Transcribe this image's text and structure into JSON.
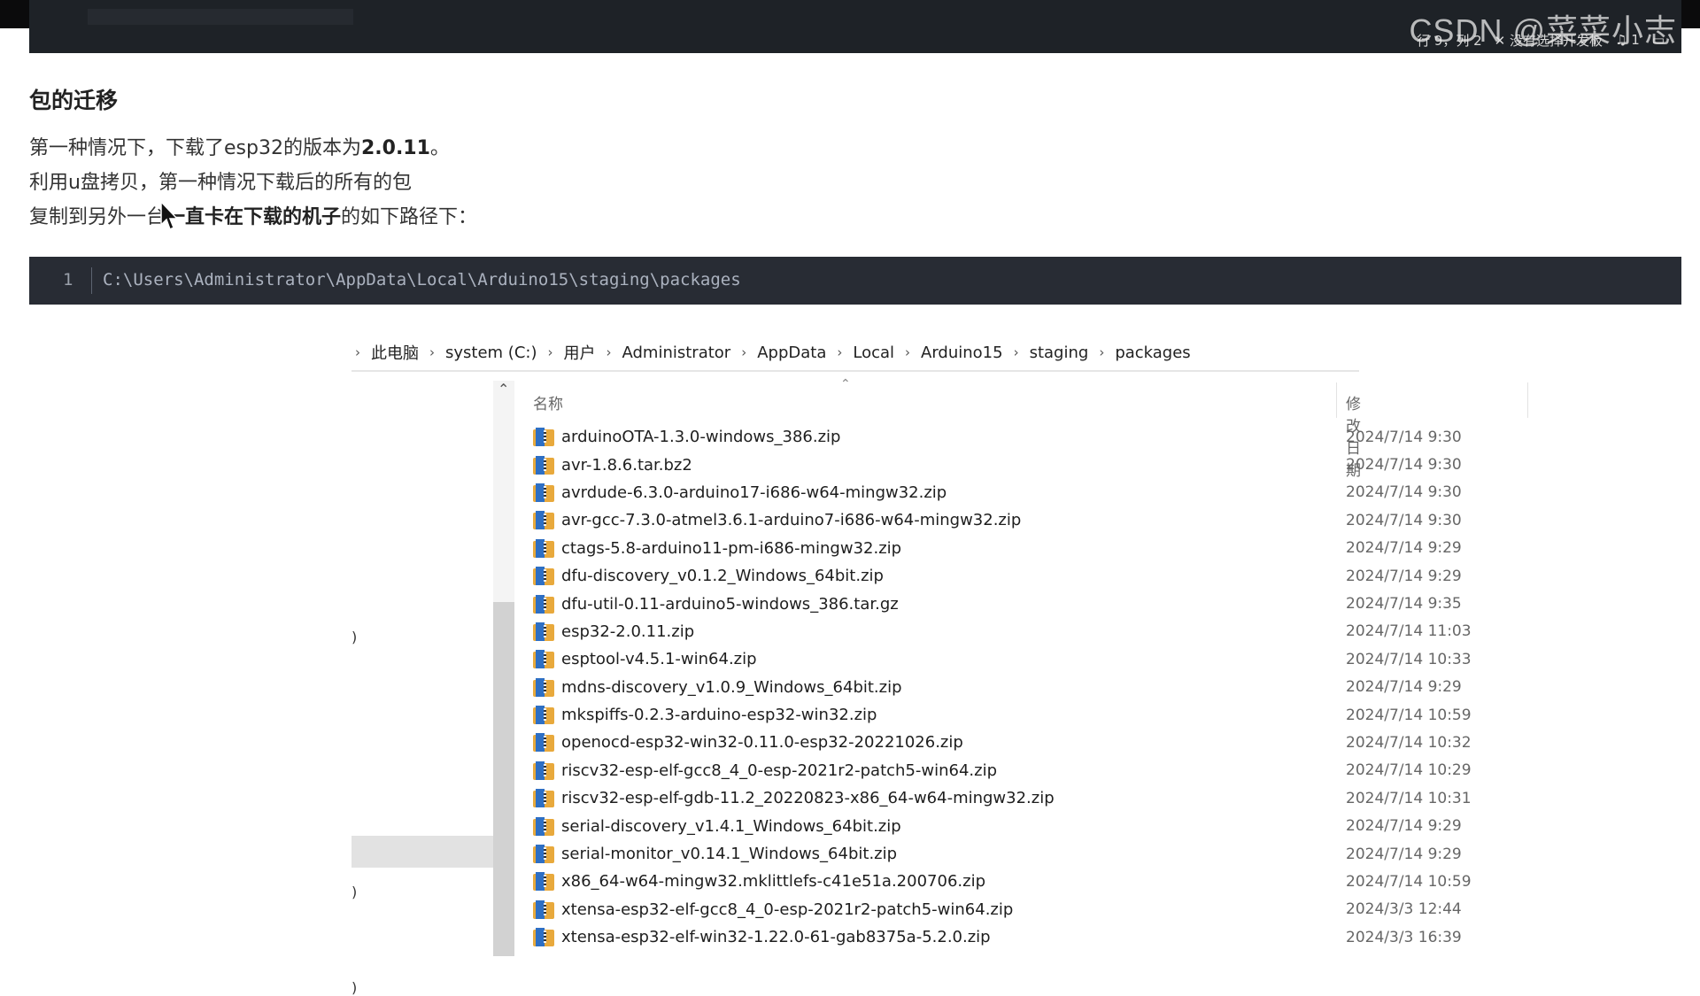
{
  "editor": {
    "status": {
      "position": "行 9，列 2",
      "board": "没有选择开发板",
      "notifications": "1"
    },
    "watermark": "CSDN @菜菜小志"
  },
  "article": {
    "heading": "包的迁移",
    "line1": {
      "text": "第一种情况下，下载了esp32的版本为",
      "bold": "2.0.11",
      "suffix": "。"
    },
    "line2": "利用u盘拷贝，第一种情况下载后的所有的包",
    "line3": {
      "prefix": "复制到另外一台",
      "bold": "一直卡在下载的机子",
      "suffix": "的如下路径下："
    }
  },
  "code": {
    "line_number": "1",
    "text": "C:\\Users\\Administrator\\AppData\\Local\\Arduino15\\staging\\packages"
  },
  "explorer": {
    "breadcrumbs": [
      "此电脑",
      "system (C:)",
      "用户",
      "Administrator",
      "AppData",
      "Local",
      "Arduino15",
      "staging",
      "packages"
    ],
    "columns": {
      "name": "名称",
      "date": "修改日期"
    },
    "files": [
      {
        "name": "arduinoOTA-1.3.0-windows_386.zip",
        "date": "2024/7/14 9:30"
      },
      {
        "name": "avr-1.8.6.tar.bz2",
        "date": "2024/7/14 9:30"
      },
      {
        "name": "avrdude-6.3.0-arduino17-i686-w64-mingw32.zip",
        "date": "2024/7/14 9:30"
      },
      {
        "name": "avr-gcc-7.3.0-atmel3.6.1-arduino7-i686-w64-mingw32.zip",
        "date": "2024/7/14 9:30"
      },
      {
        "name": "ctags-5.8-arduino11-pm-i686-mingw32.zip",
        "date": "2024/7/14 9:29"
      },
      {
        "name": "dfu-discovery_v0.1.2_Windows_64bit.zip",
        "date": "2024/7/14 9:29"
      },
      {
        "name": "dfu-util-0.11-arduino5-windows_386.tar.gz",
        "date": "2024/7/14 9:35"
      },
      {
        "name": "esp32-2.0.11.zip",
        "date": "2024/7/14 11:03"
      },
      {
        "name": "esptool-v4.5.1-win64.zip",
        "date": "2024/7/14 10:33"
      },
      {
        "name": "mdns-discovery_v1.0.9_Windows_64bit.zip",
        "date": "2024/7/14 9:29"
      },
      {
        "name": "mkspiffs-0.2.3-arduino-esp32-win32.zip",
        "date": "2024/7/14 10:59"
      },
      {
        "name": "openocd-esp32-win32-0.11.0-esp32-20221026.zip",
        "date": "2024/7/14 10:32"
      },
      {
        "name": "riscv32-esp-elf-gcc8_4_0-esp-2021r2-patch5-win64.zip",
        "date": "2024/7/14 10:29"
      },
      {
        "name": "riscv32-esp-elf-gdb-11.2_20220823-x86_64-w64-mingw32.zip",
        "date": "2024/7/14 10:31"
      },
      {
        "name": "serial-discovery_v1.4.1_Windows_64bit.zip",
        "date": "2024/7/14 9:29"
      },
      {
        "name": "serial-monitor_v0.14.1_Windows_64bit.zip",
        "date": "2024/7/14 9:29"
      },
      {
        "name": "x86_64-w64-mingw32.mklittlefs-c41e51a.200706.zip",
        "date": "2024/7/14 10:59"
      },
      {
        "name": "xtensa-esp32-elf-gcc8_4_0-esp-2021r2-patch5-win64.zip",
        "date": "2024/3/3 12:44"
      },
      {
        "name": "xtensa-esp32-elf-win32-1.22.0-61-gab8375a-5.2.0.zip",
        "date": "2024/3/3 16:39"
      }
    ]
  },
  "colors": {
    "editor_bar": "#1e2227",
    "code_bg": "#282c34",
    "zip_orange": "#e8a93c",
    "zip_blue": "#2e6fc4"
  }
}
